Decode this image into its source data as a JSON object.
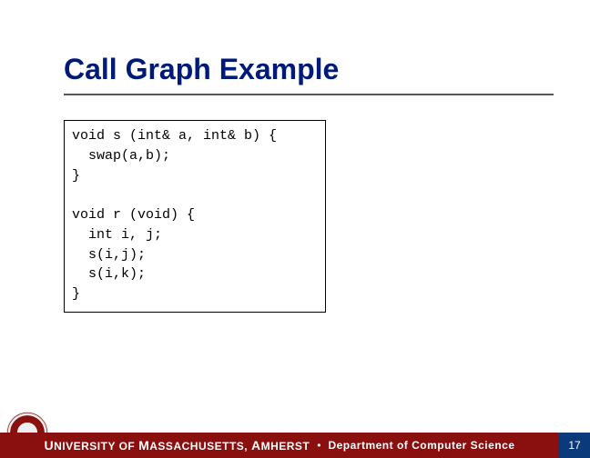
{
  "title": "Call Graph Example",
  "code": {
    "line1": "void s (int& a, int& b) {",
    "line2": "  swap(a,b);",
    "line3": "}",
    "line4": "",
    "line5": "void r (void) {",
    "line6": "  int i, j;",
    "line7": "  s(i,j);",
    "line8": "  s(i,k);",
    "line9": "}"
  },
  "footer": {
    "university_prefix_cap": "U",
    "university_prefix_rest": "NIVERSITY OF ",
    "university_mid_cap": "M",
    "university_mid_rest": "ASSACHUSETTS, ",
    "university_end_cap": "A",
    "university_end_rest": "MHERST",
    "separator": "•",
    "department": "Department of Computer Science",
    "page_number": "17"
  }
}
